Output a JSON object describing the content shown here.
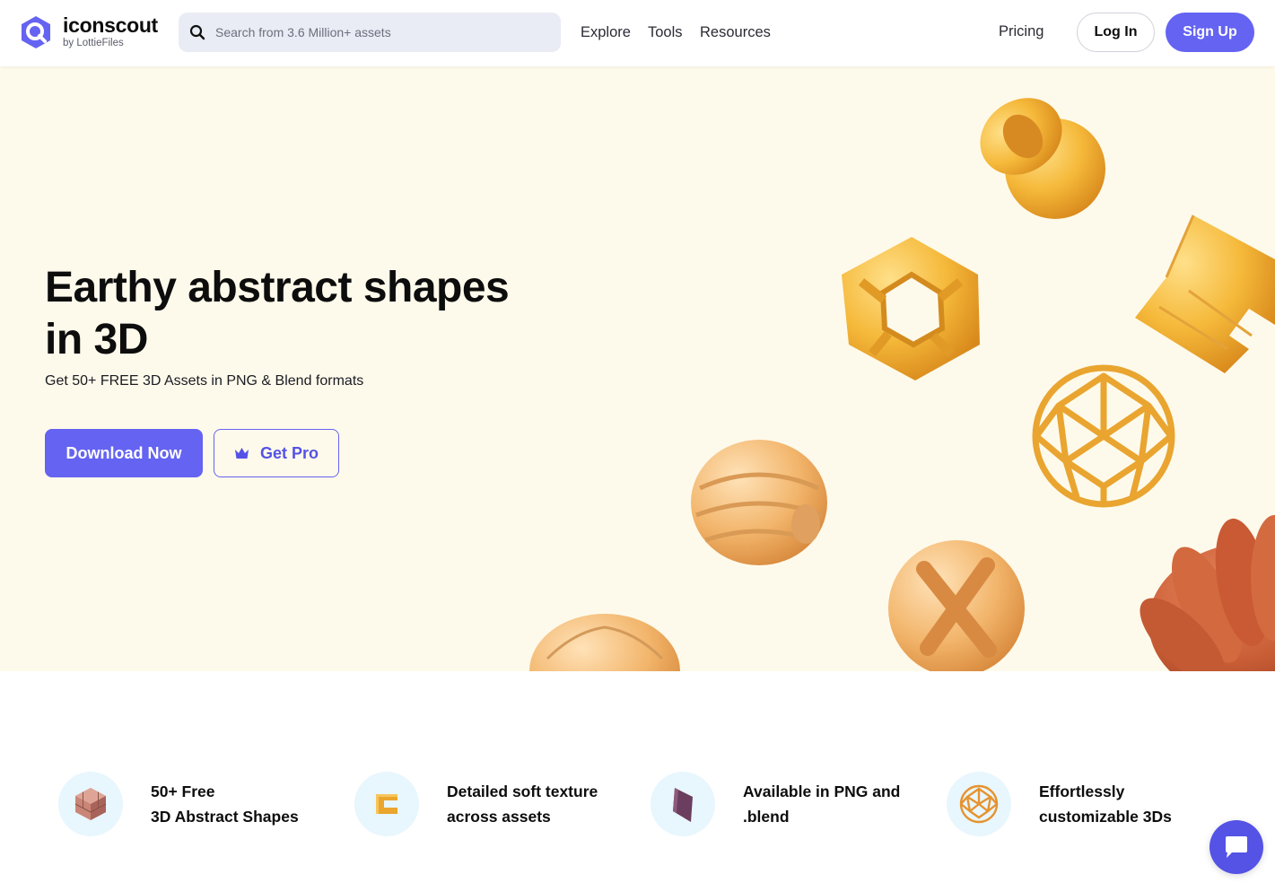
{
  "brand": {
    "name": "iconscout",
    "sub": "by LottieFiles"
  },
  "search": {
    "placeholder": "Search from 3.6 Million+ assets"
  },
  "nav": {
    "explore": "Explore",
    "tools": "Tools",
    "resources": "Resources",
    "pricing": "Pricing"
  },
  "auth": {
    "login": "Log In",
    "signup": "Sign Up"
  },
  "hero": {
    "title": "Earthy abstract shapes in 3D",
    "subtitle": "Get 50+ FREE 3D Assets in PNG & Blend formats",
    "download": "Download Now",
    "pro": "Get Pro"
  },
  "features": [
    {
      "line1": "50+ Free",
      "line2": "3D Abstract Shapes",
      "icon": "cube-icon"
    },
    {
      "line1": "Detailed soft texture",
      "line2": "across assets",
      "icon": "c-shape-icon"
    },
    {
      "line1": "Available in PNG and",
      "line2": ".blend",
      "icon": "prism-icon"
    },
    {
      "line1": "Effortlessly",
      "line2": "customizable 3Ds",
      "icon": "geosphere-icon"
    }
  ],
  "colors": {
    "accent": "#6563f2",
    "hero_bg": "#fefaeb",
    "feature_circle": "#e8f6fd"
  }
}
